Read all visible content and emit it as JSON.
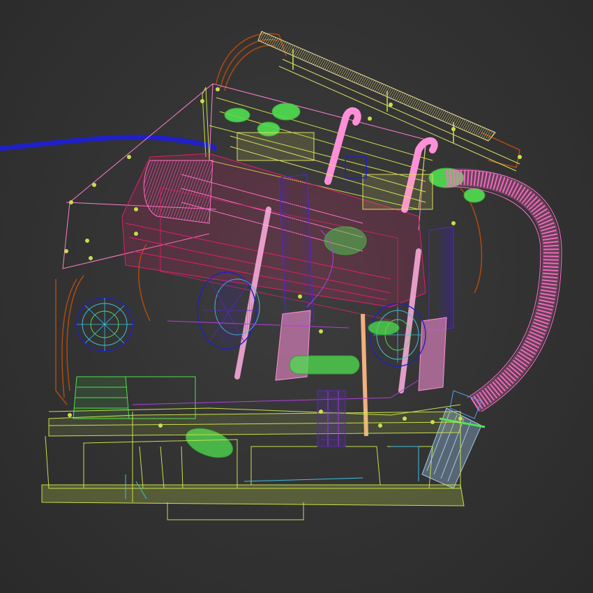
{
  "viewport": {
    "mode": "wireframe",
    "background": "#333333"
  },
  "colors": {
    "lime": "#c8e04a",
    "yellow": "#e0e070",
    "pink": "#ff6ec8",
    "magenta": "#e0206a",
    "purple": "#5a2ab0",
    "blue": "#2020c8",
    "green": "#50e050",
    "brown": "#a84a10",
    "cyan": "#40c0e0",
    "cream": "#f0e0a0",
    "salmon": "#f0a080"
  }
}
